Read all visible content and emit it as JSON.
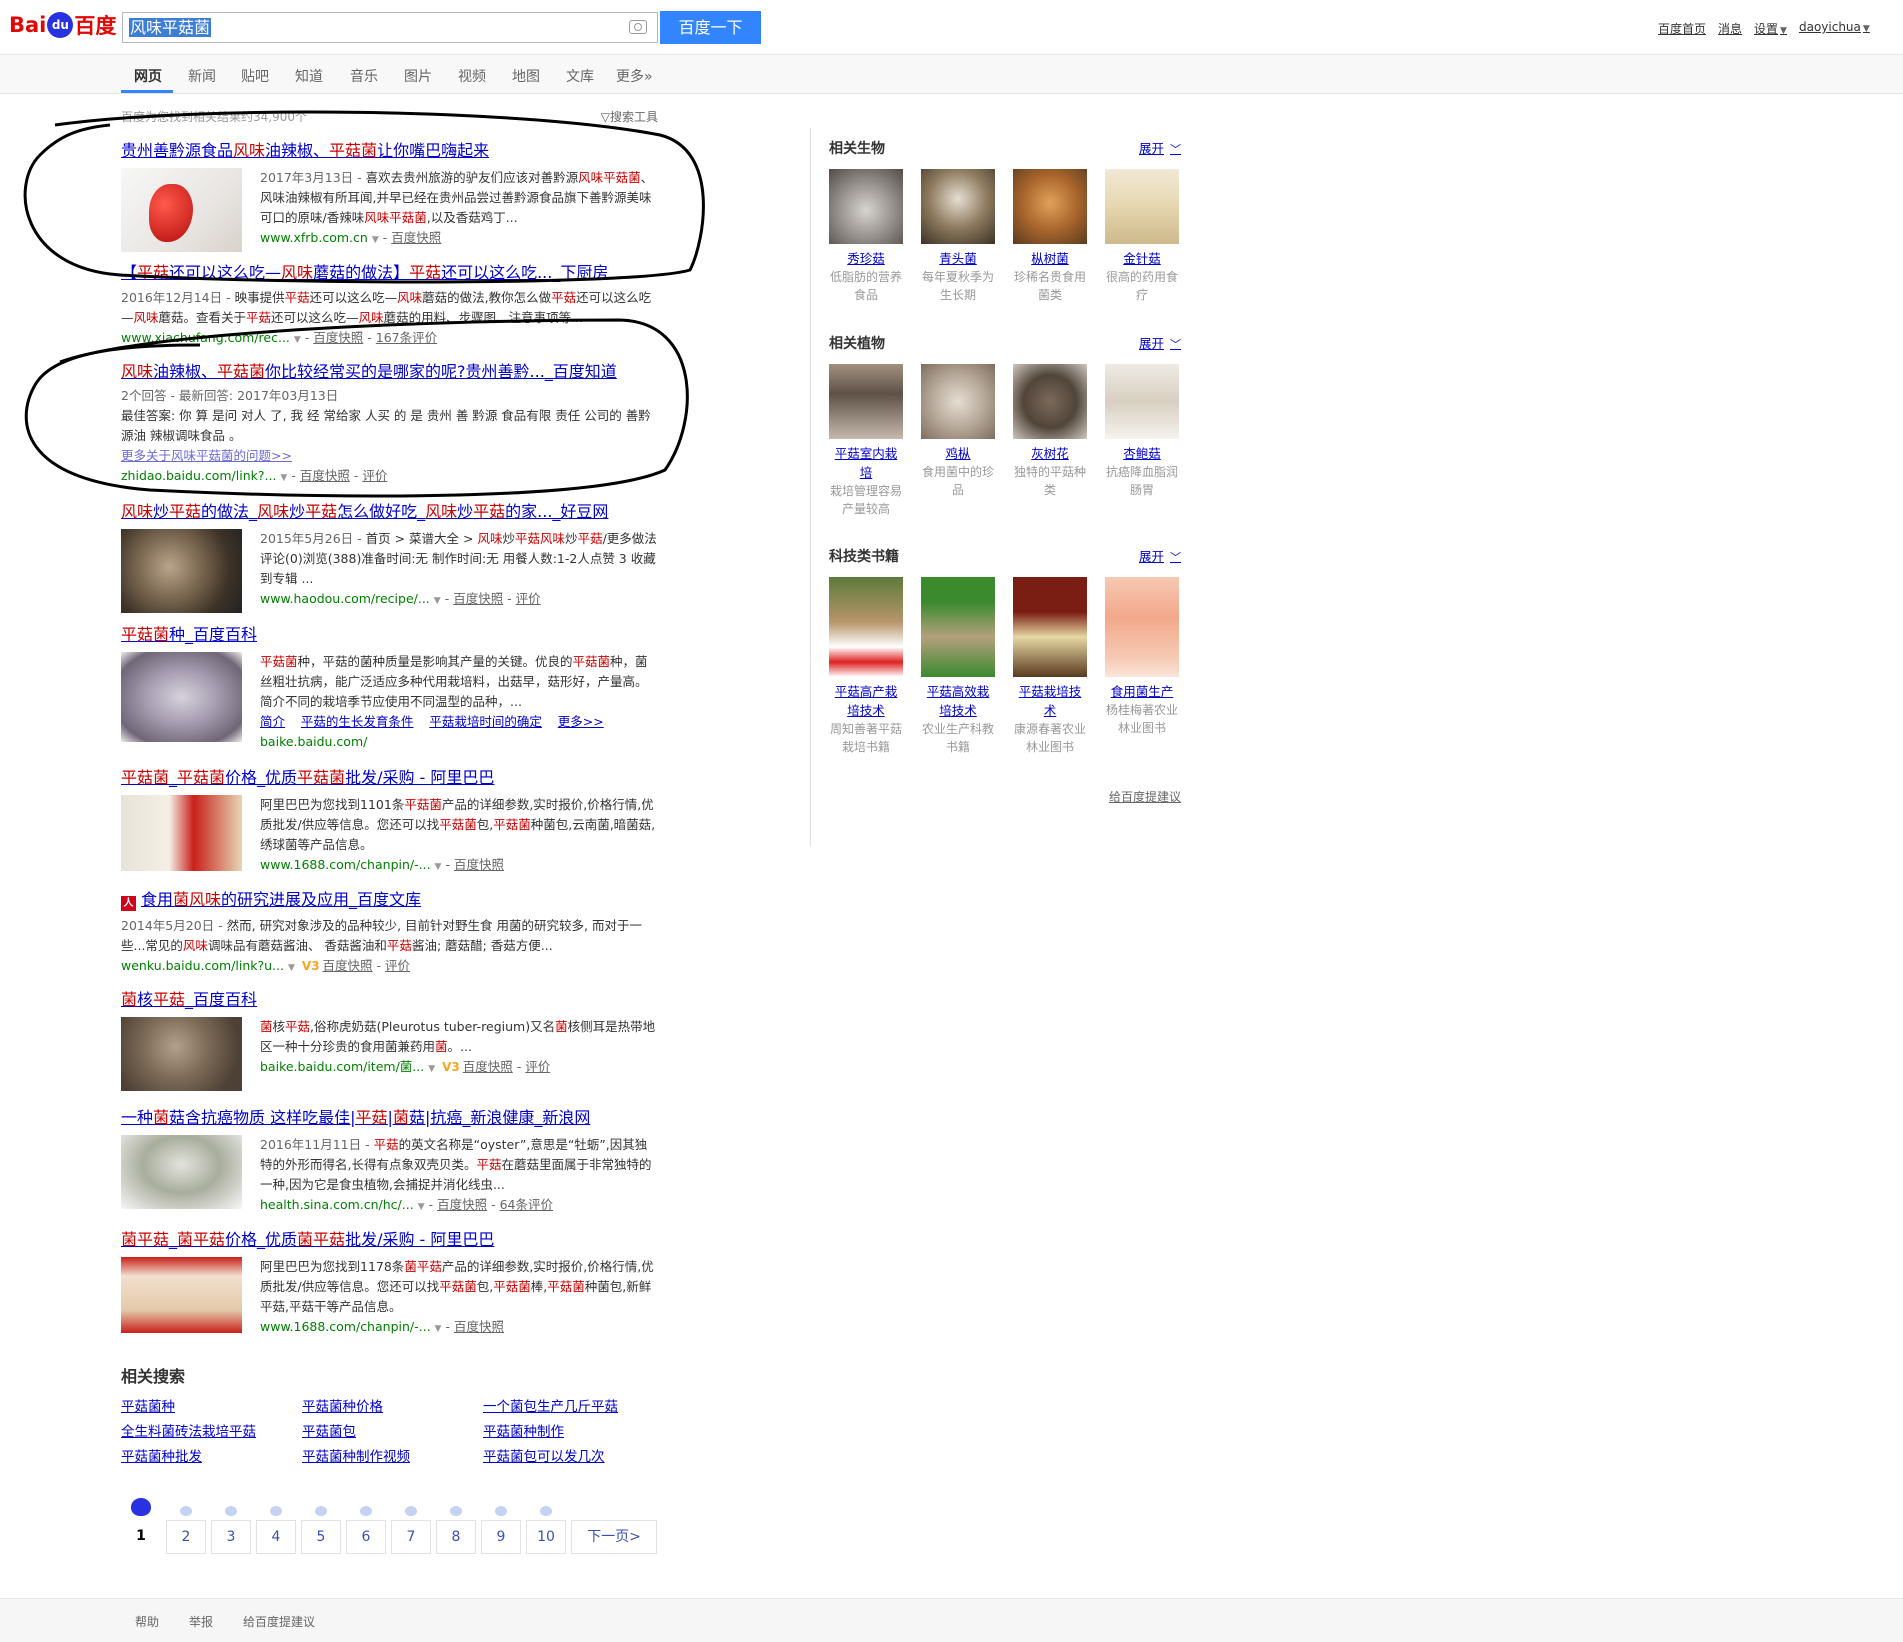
{
  "header": {
    "logo_left": "Bai",
    "logo_paw": "du",
    "logo_right": "百度",
    "query": "风味平菇菌",
    "search_button": "百度一下",
    "links": [
      "百度首页",
      "消息",
      "设置",
      "daoyichua"
    ]
  },
  "tabs": [
    "网页",
    "新闻",
    "贴吧",
    "知道",
    "音乐",
    "图片",
    "视频",
    "地图",
    "文库",
    "更多»"
  ],
  "meta": {
    "count": "百度为您找到相关结果约34,900个",
    "tools": "搜索工具"
  },
  "results": [
    {
      "title_parts": [
        [
          "贵州善黔源食品",
          ""
        ],
        [
          "风味",
          "em"
        ],
        [
          "油辣椒、",
          ""
        ],
        [
          "平菇菌",
          "em"
        ],
        [
          "让你嘴巴嗨起来",
          ""
        ]
      ],
      "abstract_parts": [
        [
          "2017年3月13日 - ",
          "date"
        ],
        [
          "喜欢去贵州旅游的驴友们应该对善黔源",
          ""
        ],
        [
          "风味平菇菌",
          "em"
        ],
        [
          "、风味油辣椒有所耳闻,并早已经在贵州品尝过善黔源食品旗下善黔源美味可口的原味/香辣味",
          ""
        ],
        [
          "风味平菇菌",
          "em"
        ],
        [
          ",以及香菇鸡丁...",
          ""
        ]
      ],
      "url": "www.xfrb.com.cn",
      "snapshot": "百度快照"
    },
    {
      "title_parts": [
        [
          "【",
          ""
        ],
        [
          "平菇",
          "em"
        ],
        [
          "还可以这么吃—",
          ""
        ],
        [
          "风味",
          "em"
        ],
        [
          "蘑菇的做法】",
          ""
        ],
        [
          "平菇",
          "em"
        ],
        [
          "还可以这么吃..._下厨房",
          ""
        ]
      ],
      "abstract_parts": [
        [
          "2016年12月14日 - ",
          "date"
        ],
        [
          "映事提供",
          ""
        ],
        [
          "平菇",
          "em"
        ],
        [
          "还可以这么吃—",
          ""
        ],
        [
          "风味",
          "em"
        ],
        [
          "蘑菇的做法,教你怎么做",
          ""
        ],
        [
          "平菇",
          "em"
        ],
        [
          "还可以这么吃—",
          ""
        ],
        [
          "风味",
          "em"
        ],
        [
          "蘑菇。查看关于",
          ""
        ],
        [
          "平菇",
          "em"
        ],
        [
          "还可以这么吃—",
          ""
        ],
        [
          "风味",
          "em"
        ],
        [
          "蘑菇的用料、步骤图、注意事项等...",
          ""
        ]
      ],
      "url": "www.xiachufang.com/rec...",
      "snapshot": "百度快照",
      "reviews": "167条评价"
    },
    {
      "title_parts": [
        [
          "风味",
          "em"
        ],
        [
          "油辣椒、",
          ""
        ],
        [
          "平菇菌",
          "em"
        ],
        [
          "你比较经常买的是哪家的呢?贵州善黔..._百度知道",
          ""
        ]
      ],
      "answer_meta": "2个回答 - 最新回答: 2017年03月13日",
      "abstract": "最佳答案: 你 算 是问 对人 了, 我 经 常给家 人买 的 是 贵州 善 黔源 食品有限 责任 公司的 善黔源油 辣椒调味食品 。",
      "more_link": "更多关于风味平菇菌的问题>>",
      "url": "zhidao.baidu.com/link?...",
      "snapshot": "百度快照",
      "reviews": "评价"
    },
    {
      "title_parts": [
        [
          "风味",
          "em"
        ],
        [
          "炒",
          ""
        ],
        [
          "平菇",
          "em"
        ],
        [
          "的做法_",
          ""
        ],
        [
          "风味",
          "em"
        ],
        [
          "炒",
          ""
        ],
        [
          "平菇",
          "em"
        ],
        [
          "怎么做好吃_",
          ""
        ],
        [
          "风味",
          "em"
        ],
        [
          "炒",
          ""
        ],
        [
          "平菇",
          "em"
        ],
        [
          "的家..._好豆网",
          ""
        ]
      ],
      "abstract_parts": [
        [
          "2015年5月26日 - ",
          "date"
        ],
        [
          "首页 > 菜谱大全 > ",
          ""
        ],
        [
          "风味",
          "em"
        ],
        [
          "炒",
          ""
        ],
        [
          "平菇",
          "em"
        ],
        [
          "风味",
          "em"
        ],
        [
          "炒",
          ""
        ],
        [
          "平菇",
          "em"
        ],
        [
          "/更多做法 评论(0)浏览(388)准备时间:无 制作时间:无 用餐人数:1-2人点赞 3 收藏 到专辑 ...",
          ""
        ]
      ],
      "url": "www.haodou.com/recipe/...",
      "snapshot": "百度快照",
      "reviews": "评价"
    },
    {
      "title_parts": [
        [
          "平菇菌",
          "em"
        ],
        [
          "种_百度百科",
          ""
        ]
      ],
      "abstract_parts": [
        [
          "平菇菌",
          "em"
        ],
        [
          "种，平菇的菌种质量是影响其产量的关键。优良的",
          ""
        ],
        [
          "平菇菌",
          "em"
        ],
        [
          "种，菌丝粗壮抗病，能广泛适应多种代用栽培料，出菇早，菇形好，产量高。简介不同的栽培季节应使用不同温型的品种，...",
          ""
        ]
      ],
      "sublinks": [
        "简介",
        "平菇的生长发育条件",
        "平菇栽培时间的确定",
        "更多>>"
      ],
      "url": "baike.baidu.com/"
    },
    {
      "title_parts": [
        [
          "平菇菌",
          "em"
        ],
        [
          "_",
          ""
        ],
        [
          "平菇菌",
          "em"
        ],
        [
          "价格_优质",
          ""
        ],
        [
          "平菇菌",
          "em"
        ],
        [
          "批发/采购 - 阿里巴巴",
          ""
        ]
      ],
      "abstract_parts": [
        [
          "阿里巴巴为您找到1101条",
          ""
        ],
        [
          "平菇菌",
          "em"
        ],
        [
          "产品的详细参数,实时报价,价格行情,优质批发/供应等信息。您还可以找",
          ""
        ],
        [
          "平菇菌",
          "em"
        ],
        [
          "包,",
          ""
        ],
        [
          "平菇菌",
          "em"
        ],
        [
          "种菌包,云南菌,暗菌菇,绣球菌等产品信息。",
          ""
        ]
      ],
      "url": "www.1688.com/chanpin/-...",
      "snapshot": "百度快照"
    },
    {
      "doc_icon": "人",
      "title_parts": [
        [
          "食用",
          ""
        ],
        [
          "菌风味",
          "em"
        ],
        [
          "的研究进展及应用_百度文库",
          ""
        ]
      ],
      "abstract_parts": [
        [
          "2014年5月20日 - ",
          "date"
        ],
        [
          "然而, 研究对象涉及的品种较少, 目前针对野生食 用菌的研究较多, 而对于一些...常见的",
          ""
        ],
        [
          "风味",
          "em"
        ],
        [
          "调味品有蘑菇酱油、 香菇酱油和",
          ""
        ],
        [
          "平菇",
          "em"
        ],
        [
          "酱油; 蘑菇醋; 香菇方便...",
          ""
        ]
      ],
      "url": "wenku.baidu.com/link?u...",
      "vbadge": "V3",
      "snapshot": "百度快照",
      "reviews": "评价"
    },
    {
      "title_parts": [
        [
          "菌",
          "em"
        ],
        [
          "核",
          ""
        ],
        [
          "平菇",
          "em"
        ],
        [
          "_百度百科",
          ""
        ]
      ],
      "abstract_parts": [
        [
          "菌",
          "em"
        ],
        [
          "核",
          ""
        ],
        [
          "平菇",
          "em"
        ],
        [
          ",俗称虎奶菇(Pleurotus tuber-regium)又名",
          ""
        ],
        [
          "菌",
          "em"
        ],
        [
          "核侧耳是热带地区一种十分珍贵的食用菌兼药用",
          ""
        ],
        [
          "菌",
          "em"
        ],
        [
          "。...",
          ""
        ]
      ],
      "url": "baike.baidu.com/item/菌...",
      "vbadge": "V3",
      "snapshot": "百度快照",
      "reviews": "评价"
    },
    {
      "title_parts": [
        [
          "一种",
          ""
        ],
        [
          "菌",
          "em"
        ],
        [
          "菇含抗癌物质 这样吃最佳|",
          ""
        ],
        [
          "平菇",
          "em"
        ],
        [
          "|",
          ""
        ],
        [
          "菌",
          "em"
        ],
        [
          "菇|抗癌_新浪健康_新浪网",
          ""
        ]
      ],
      "abstract_parts": [
        [
          "2016年11月11日 - ",
          "date"
        ],
        [
          "平菇",
          "em"
        ],
        [
          "的英文名称是“oyster”,意思是“牡蛎”,因其独特的外形而得名,长得有点象双壳贝类。",
          ""
        ],
        [
          "平菇",
          "em"
        ],
        [
          "在蘑菇里面属于非常独特的一种,因为它是食虫植物,会捕捉并消化线虫...",
          ""
        ]
      ],
      "url": "health.sina.com.cn/hc/...",
      "snapshot": "百度快照",
      "reviews": "64条评价"
    },
    {
      "title_parts": [
        [
          "菌平菇",
          "em"
        ],
        [
          "_",
          ""
        ],
        [
          "菌平菇",
          "em"
        ],
        [
          "价格_优质",
          ""
        ],
        [
          "菌平菇",
          "em"
        ],
        [
          "批发/采购 - 阿里巴巴",
          ""
        ]
      ],
      "abstract_parts": [
        [
          "阿里巴巴为您找到1178条",
          ""
        ],
        [
          "菌平菇",
          "em"
        ],
        [
          "产品的详细参数,实时报价,价格行情,优质批发/供应等信息。您还可以找",
          ""
        ],
        [
          "平菇菌",
          "em"
        ],
        [
          "包,",
          ""
        ],
        [
          "平菇菌",
          "em"
        ],
        [
          "棒,",
          ""
        ],
        [
          "平菇菌",
          "em"
        ],
        [
          "种菌包,新鲜平菇,平菇干等产品信息。",
          ""
        ]
      ],
      "url": "www.1688.com/chanpin/-...",
      "snapshot": "百度快照"
    }
  ],
  "related_searches": {
    "title": "相关搜索",
    "items": [
      "平菇菌种",
      "平菇菌种价格",
      "一个菌包生产几斤平菇",
      "全生料菌砖法栽培平菇",
      "平菇菌包",
      "平菇菌种制作",
      "平菇菌种批发",
      "平菇菌种制作视频",
      "平菇菌包可以发几次"
    ]
  },
  "pager": {
    "pages": [
      "1",
      "2",
      "3",
      "4",
      "5",
      "6",
      "7",
      "8",
      "9",
      "10"
    ],
    "next": "下一页>"
  },
  "footer": [
    "帮助",
    "举报",
    "给百度提建议"
  ],
  "right_panel": {
    "sections": [
      {
        "title": "相关生物",
        "more": "展开",
        "items": [
          {
            "name": "秀珍菇",
            "desc": "低脂肪的营养食品"
          },
          {
            "name": "青头菌",
            "desc": "每年夏秋季为生长期"
          },
          {
            "name": "枞树菌",
            "desc": "珍稀名贵食用菌类"
          },
          {
            "name": "金针菇",
            "desc": "很高的药用食疗"
          }
        ]
      },
      {
        "title": "相关植物",
        "more": "展开",
        "items": [
          {
            "name": "平菇室内栽培",
            "desc": "栽培管理容易产量较高"
          },
          {
            "name": "鸡枞",
            "desc": "食用菌中的珍品"
          },
          {
            "name": "灰树花",
            "desc": "独特的平菇种类"
          },
          {
            "name": "杏鲍菇",
            "desc": "抗癌降血脂润肠胃"
          }
        ]
      },
      {
        "title": "科技类书籍",
        "more": "展开",
        "items": [
          {
            "name": "平菇高产栽培技术",
            "desc": "周知善著平菇栽培书籍"
          },
          {
            "name": "平菇高效栽培技术",
            "desc": "农业生产科教书籍"
          },
          {
            "name": "平菇栽培技术",
            "desc": "康源春著农业林业图书"
          },
          {
            "name": "食用菌生产",
            "desc": "杨桂梅著农业林业图书"
          }
        ]
      }
    ],
    "feedback": "给百度提建议"
  }
}
